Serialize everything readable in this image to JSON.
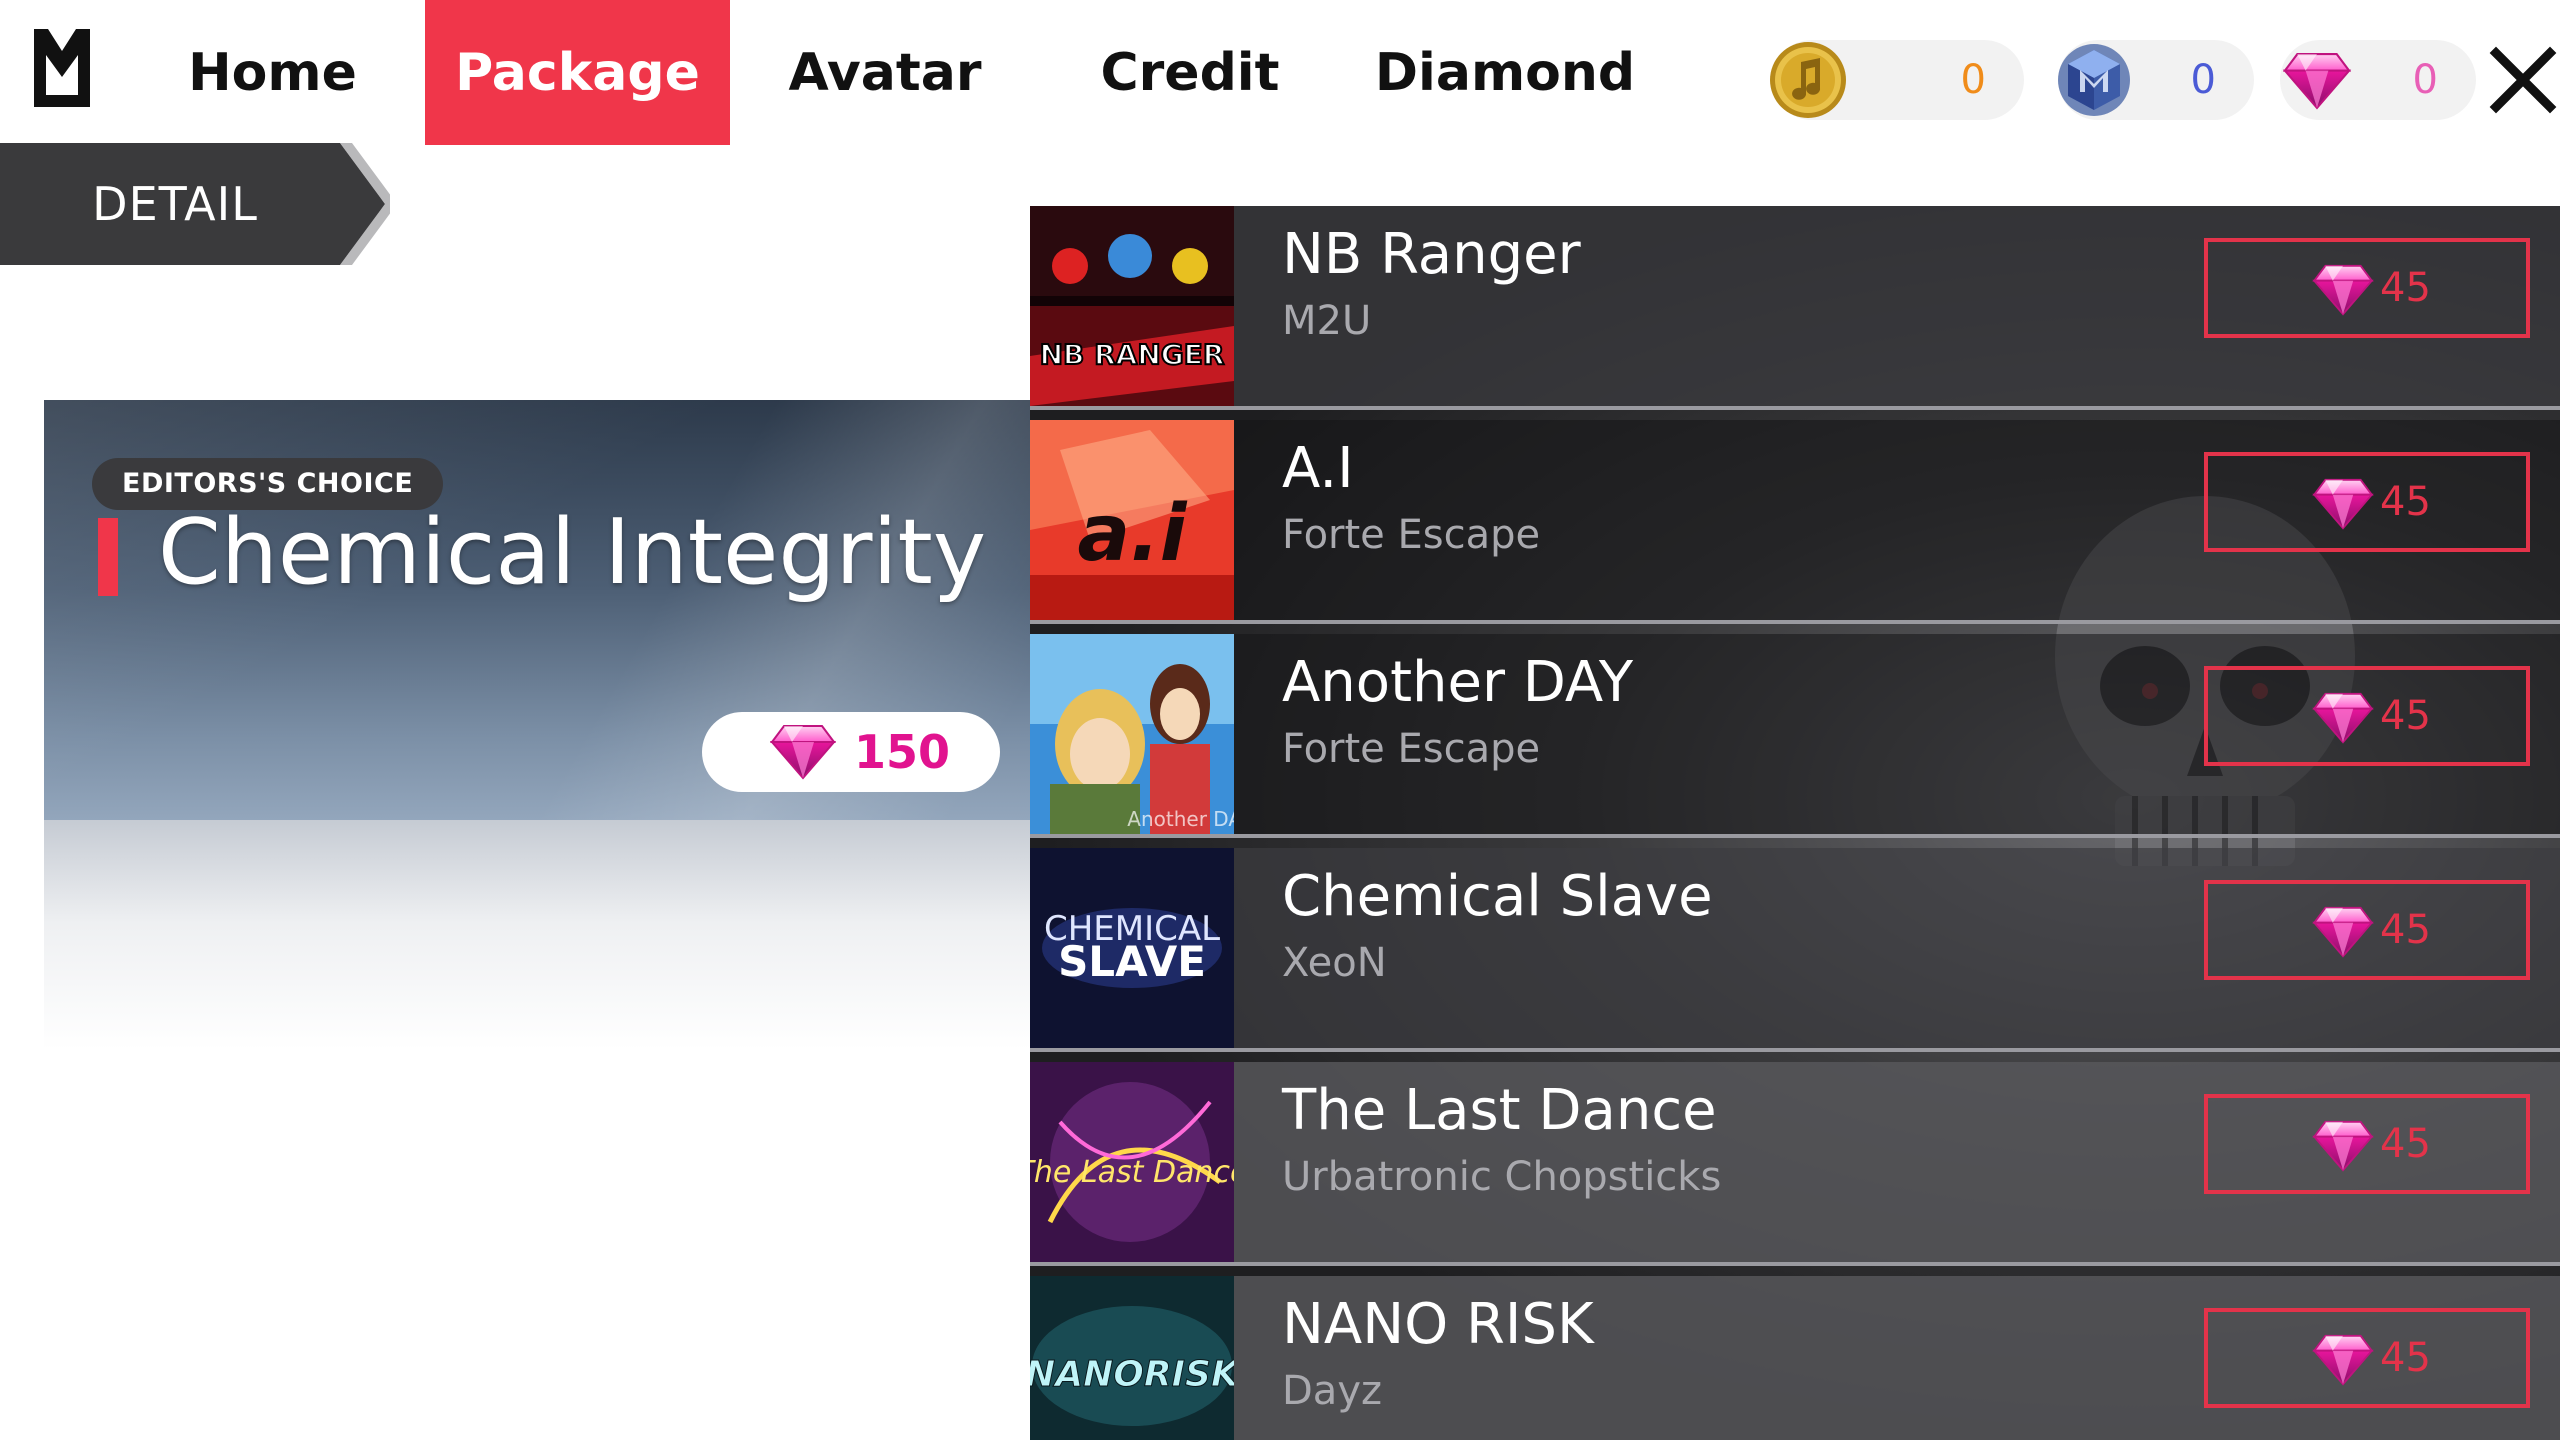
{
  "nav": {
    "tabs": [
      {
        "label": "Home"
      },
      {
        "label": "Package",
        "active": true
      },
      {
        "label": "Avatar"
      },
      {
        "label": "Credit"
      },
      {
        "label": "Diamond"
      }
    ]
  },
  "currencies": [
    {
      "icon": "music-coin-icon",
      "value": "0",
      "color": "#f08c1a"
    },
    {
      "icon": "cube-gem-icon",
      "value": "0",
      "color": "#4b5bd6"
    },
    {
      "icon": "diamond-icon",
      "value": "0",
      "color": "#e85fb6"
    }
  ],
  "detail_tab": {
    "label": "DETAIL"
  },
  "featured": {
    "badge": "EDITORS'S CHOICE",
    "title": "Chemical Integrity",
    "price": "150",
    "accent": "#f0364a"
  },
  "songs": [
    {
      "title": "NB Ranger",
      "artist": "M2U",
      "price": "45",
      "cover": "NB RANGER"
    },
    {
      "title": "A.I",
      "artist": "Forte Escape",
      "price": "45",
      "cover": "a.i"
    },
    {
      "title": "Another DAY",
      "artist": "Forte Escape",
      "price": "45",
      "cover": "Another DAY"
    },
    {
      "title": "Chemical Slave",
      "artist": "XeoN",
      "price": "45",
      "cover": "CHEMICAL SLAVE"
    },
    {
      "title": "The Last Dance",
      "artist": "Urbatronic Chopsticks",
      "price": "45",
      "cover": "The Last Dance"
    },
    {
      "title": "NANO RISK",
      "artist": "Dayz",
      "price": "45",
      "cover": "NANORISK"
    }
  ]
}
